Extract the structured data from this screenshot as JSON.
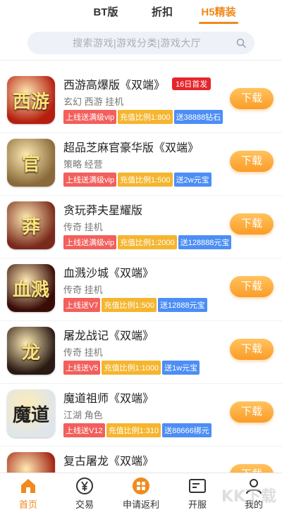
{
  "tabs": [
    {
      "label": "BT版",
      "active": false
    },
    {
      "label": "折扣",
      "active": false
    },
    {
      "label": "H5精装",
      "active": true
    }
  ],
  "search": {
    "placeholder": "搜索游戏|游戏分类|游戏大厅"
  },
  "download_label": "下载",
  "games": [
    {
      "name": "西游高爆版《双端》",
      "badge": "16日首发",
      "tags": "玄幻 西游 挂机",
      "labels": [
        {
          "text": "上线送满级vip",
          "color": "red"
        },
        {
          "text": "充值比例1:800",
          "color": "yellow"
        },
        {
          "text": "送38888钻石",
          "color": "blue"
        }
      ],
      "icon_text": "西游",
      "icon_bg": "#b51f10"
    },
    {
      "name": "超品芝麻官豪华版《双端》",
      "badge": "",
      "tags": "策略 经营",
      "labels": [
        {
          "text": "上线送满级vip",
          "color": "red"
        },
        {
          "text": "充值比例1:500",
          "color": "yellow"
        },
        {
          "text": "送2w元宝",
          "color": "blue"
        }
      ],
      "icon_text": "官",
      "icon_bg": "#8a6a3a"
    },
    {
      "name": "贪玩莽夫星耀版",
      "badge": "",
      "tags": "传奇 挂机",
      "labels": [
        {
          "text": "上线送满级vip",
          "color": "red"
        },
        {
          "text": "充值比例1:2000",
          "color": "yellow"
        },
        {
          "text": "送128888元宝",
          "color": "blue"
        }
      ],
      "icon_text": "莽",
      "icon_bg": "#7a2a1c"
    },
    {
      "name": "血溅沙城《双端》",
      "badge": "",
      "tags": "传奇 挂机",
      "labels": [
        {
          "text": "上线送V7",
          "color": "red"
        },
        {
          "text": "充值比例1:500",
          "color": "yellow"
        },
        {
          "text": "送12888元宝",
          "color": "blue"
        }
      ],
      "icon_text": "血溅",
      "icon_bg": "#3a0c08"
    },
    {
      "name": "屠龙战记《双端》",
      "badge": "",
      "tags": "传奇 挂机",
      "labels": [
        {
          "text": "上线送V5",
          "color": "red"
        },
        {
          "text": "充值比例1:1000",
          "color": "yellow"
        },
        {
          "text": "送1w元宝",
          "color": "blue"
        }
      ],
      "icon_text": "龙",
      "icon_bg": "#2a1a14"
    },
    {
      "name": "魔道祖师《双端》",
      "badge": "",
      "tags": "江湖 角色",
      "labels": [
        {
          "text": "上线送V12",
          "color": "red"
        },
        {
          "text": "充值比例1:310",
          "color": "yellow"
        },
        {
          "text": "送88666绑元",
          "color": "blue"
        }
      ],
      "icon_text": "魔道",
      "icon_bg": "#dfe6ea"
    },
    {
      "name": "复古屠龙《双端》",
      "badge": "",
      "tags": "",
      "labels": [],
      "icon_text": "",
      "icon_bg": "#a02010"
    }
  ],
  "nav": [
    {
      "label": "首页",
      "icon": "home-icon",
      "active": true
    },
    {
      "label": "交易",
      "icon": "yen-icon",
      "active": false
    },
    {
      "label": "申请返利",
      "icon": "apps-icon",
      "active": false
    },
    {
      "label": "开服",
      "icon": "server-icon",
      "active": false
    },
    {
      "label": "我的",
      "icon": "user-icon",
      "active": false
    }
  ],
  "colors": {
    "accent": "#f08a1c",
    "red_tag": "#f25f5c",
    "yellow_tag": "#f5b52e",
    "blue_tag": "#4c8ef5"
  },
  "watermark": "KK下载"
}
